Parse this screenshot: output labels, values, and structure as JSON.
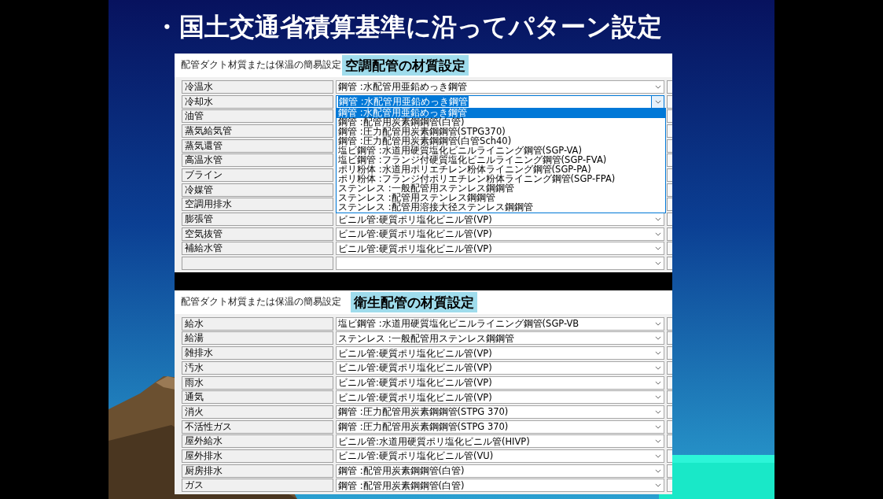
{
  "slide": {
    "title": "・国土交通省積算基準に沿ってパターン設定"
  },
  "panels": [
    {
      "caption": "配管ダクト材質または保温の簡易設定",
      "heading": "空調配管の材質設定",
      "rows": [
        {
          "label": "冷温水",
          "value": "鋼管 :水配管用亜鉛めっき鋼管",
          "expanded": false
        },
        {
          "label": "冷却水",
          "value": "鋼管 :水配管用亜鉛めっき鋼管",
          "expanded": true,
          "options": [
            {
              "label": "鋼管 :水配管用亜鉛めっき鋼管",
              "selected": true
            },
            {
              "label": "鋼管 :配管用炭素鋼鋼管(白管)",
              "selected": false
            },
            {
              "label": "鋼管 :圧力配管用炭素鋼鋼管(STPG370)",
              "selected": false
            },
            {
              "label": "鋼管 :圧力配管用炭素鋼鋼管(白管Sch40)",
              "selected": false
            },
            {
              "label": "塩ビ鋼管 :水道用硬質塩化ビニルライニング鋼管(SGP-VA)",
              "selected": false
            },
            {
              "label": "塩ビ鋼管 :フランジ付硬質塩化ビニルライニング鋼管(SGP-FVA)",
              "selected": false
            },
            {
              "label": "ポリ粉体 :水道用ポリエチレン粉体ライニング鋼管(SGP-PA)",
              "selected": false
            },
            {
              "label": "ポリ粉体 :フランジ付ポリエチレン粉体ライニング鋼管(SGP-FPA)",
              "selected": false
            },
            {
              "label": "ステンレス :一般配管用ステンレス鋼鋼管",
              "selected": false
            },
            {
              "label": "ステンレス :配管用ステンレス鋼鋼管",
              "selected": false
            },
            {
              "label": "ステンレス :配管用溶接大径ステンレス鋼鋼管",
              "selected": false
            }
          ]
        },
        {
          "label": "油管",
          "expanded": false,
          "covered": true
        },
        {
          "label": "蒸気給気管",
          "expanded": false,
          "covered": true
        },
        {
          "label": "蒸気還管",
          "expanded": false,
          "covered": true
        },
        {
          "label": "高温水管",
          "expanded": false,
          "covered": true
        },
        {
          "label": "ブライン",
          "expanded": false,
          "covered": true
        },
        {
          "label": "冷媒管",
          "expanded": false,
          "covered": true
        },
        {
          "label": "空調用排水",
          "expanded": false,
          "covered": true
        },
        {
          "label": "膨張管",
          "value": "ビニル管:硬質ポリ塩化ビニル管(VP)",
          "expanded": false
        },
        {
          "label": "空気抜管",
          "value": "ビニル管:硬質ポリ塩化ビニル管(VP)",
          "expanded": false
        },
        {
          "label": "補給水管",
          "value": "ビニル管:硬質ポリ塩化ビニル管(VP)",
          "expanded": false
        },
        {
          "expanded": false
        }
      ]
    },
    {
      "caption": "配管ダクト材質または保温の簡易設定",
      "heading": "衛生配管の材質設定",
      "rows": [
        {
          "label": "給水",
          "value": "塩ビ鋼管 :水道用硬質塩化ビニルライニング鋼管(SGP-VB",
          "expanded": false
        },
        {
          "label": "給湯",
          "value": "ステンレス :一般配管用ステンレス鋼鋼管",
          "expanded": false
        },
        {
          "label": "雑排水",
          "value": "ビニル管:硬質ポリ塩化ビニル管(VP)",
          "expanded": false
        },
        {
          "label": "汚水",
          "value": "ビニル管:硬質ポリ塩化ビニル管(VP)",
          "expanded": false
        },
        {
          "label": "雨水",
          "value": "ビニル管:硬質ポリ塩化ビニル管(VP)",
          "expanded": false
        },
        {
          "label": "通気",
          "value": "ビニル管:硬質ポリ塩化ビニル管(VP)",
          "expanded": false
        },
        {
          "label": "消火",
          "value": "鋼管 :圧力配管用炭素鋼鋼管(STPG 370)",
          "expanded": false
        },
        {
          "label": "不活性ガス",
          "value": "鋼管 :圧力配管用炭素鋼鋼管(STPG 370)",
          "expanded": false
        },
        {
          "label": "屋外給水",
          "value": "ビニル管:水道用硬質ポリ塩化ビニル管(HIVP)",
          "expanded": false
        },
        {
          "label": "屋外排水",
          "value": "ビニル管:硬質ポリ塩化ビニル管(VU)",
          "expanded": false
        },
        {
          "label": "厨房排水",
          "value": "鋼管 :配管用炭素鋼鋼管(白管)",
          "expanded": false
        },
        {
          "label": "ガス",
          "value": "鋼管 :配管用炭素鋼鋼管(白管)",
          "expanded": false
        }
      ]
    }
  ]
}
